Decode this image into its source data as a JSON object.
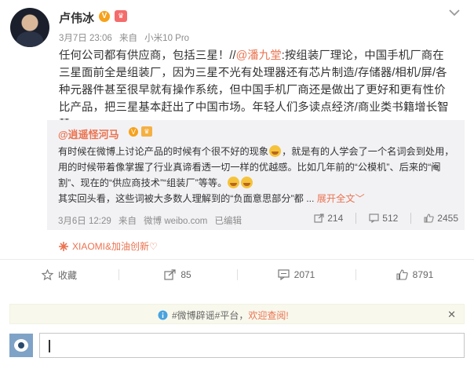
{
  "author": {
    "name": "卢伟冰",
    "time": "3月7日 23:06",
    "from_prefix": "来自",
    "device": "小米10 Pro"
  },
  "content": {
    "part1": "任何公司都有供应商，包括三星！//",
    "mention": "@潘九堂",
    "part2": ":按组装厂理论，中国手机厂商在三星面前全是组装厂，因为三星不光有处理器还有芯片制造/存储器/相机/屏/各种元器件甚至很早就有操作系统，但中国手机厂商还是做出了更好和更有性价比产品，把三星基本赶出了中国市场。年轻人们多读点经济/商业类书籍增长智慧"
  },
  "retweet": {
    "author": "@逍遥怪河马",
    "text1": "有时候在微博上讨论产品的时候有个很不好的现象",
    "text2": "，就是有的人学会了一个名词会到处用，用的时候带着像掌握了行业真谛看透一切一样的优越感。比如几年前的“公模机”、后来的“阉割”、现在的“供应商技术”“组装厂”等等。",
    "text3": "其实回头看，这些词被大多数人理解到的“负面意思部分”都 ...",
    "expand_label": "展开全文",
    "expand_arrow": "﹀",
    "time": "3月6日 12:29",
    "from_prefix": "来自",
    "from": "微博 weibo.com",
    "edited": "已编辑",
    "reposts": "214",
    "comments": "512",
    "likes": "2455"
  },
  "source": {
    "label": "XIAOMI&加油创新♡"
  },
  "actions": {
    "favorite": "收藏",
    "forward": "85",
    "comment": "2071",
    "like": "8791"
  },
  "tip": {
    "prefix": "#微博辟谣#平台，",
    "link": "欢迎查阅!",
    "close": "✕"
  },
  "composer": {
    "value": ""
  },
  "colors": {
    "accent": "#eb7350",
    "retweet_bg": "#f2f2f5",
    "tip_bg": "#f8f8ed"
  }
}
